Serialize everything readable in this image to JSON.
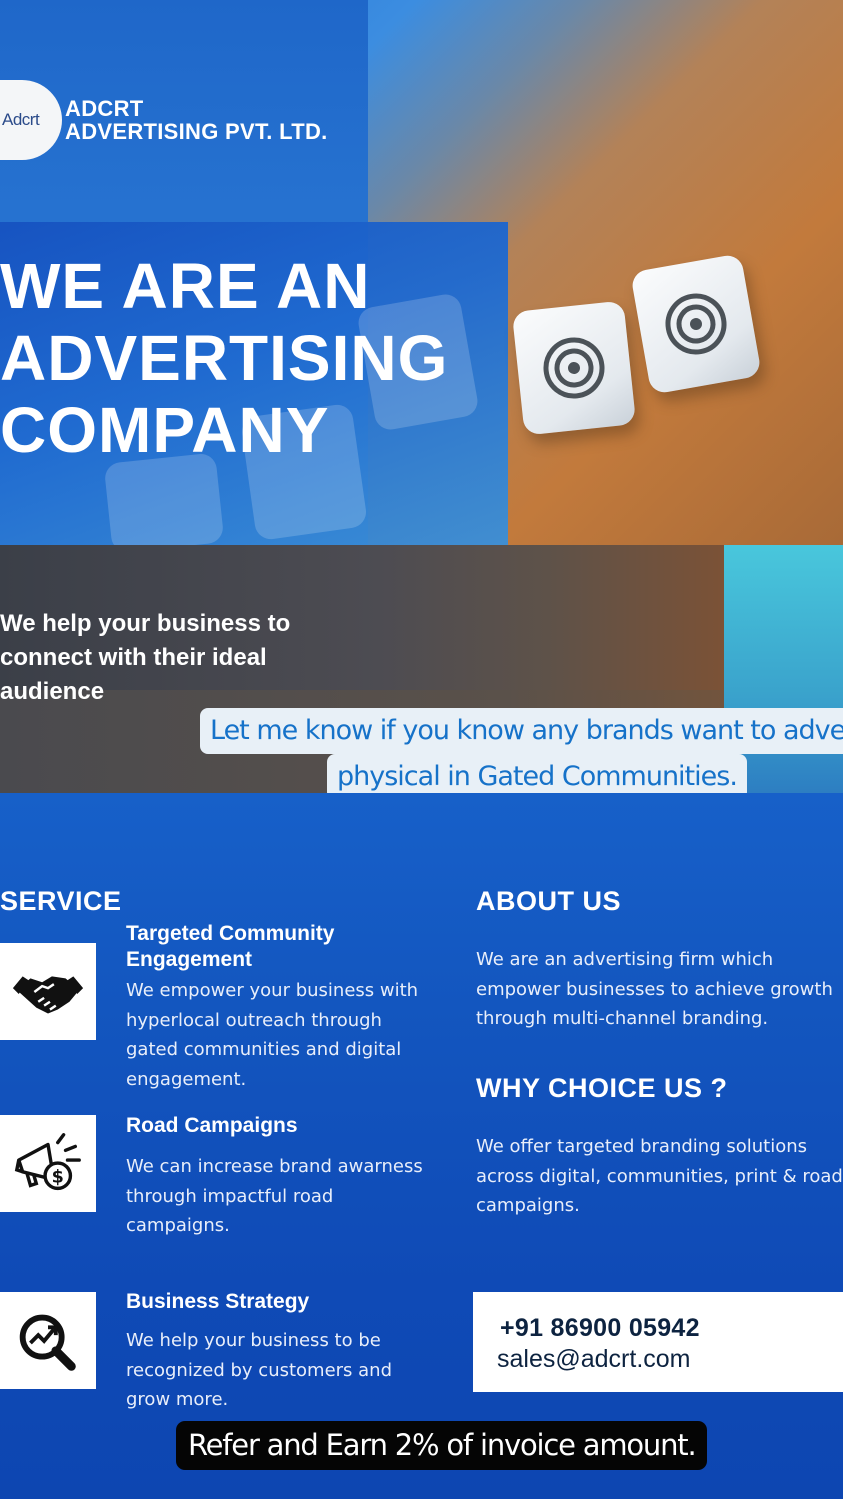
{
  "brand": {
    "logo_mark": "Adcrt",
    "name_line1": "ADCRT",
    "name_line2": "ADVERTISING PVT. LTD."
  },
  "hero": {
    "headline": [
      "WE ARE AN",
      "ADVERTISING",
      "COMPANY"
    ]
  },
  "tagline": [
    "We help your business to",
    "connect with their ideal",
    "audience"
  ],
  "overlay_text": {
    "line1": "Let me know if you know any brands want to advertise",
    "line2": "physical in Gated Communities."
  },
  "service": {
    "heading": "SERVICE",
    "items": [
      {
        "icon": "handshake-icon",
        "title_lines": [
          "Targeted Community",
          "Engagement"
        ],
        "desc_lines": [
          "We empower your business with",
          "hyperlocal outreach through",
          "gated communities and digital",
          "engagement."
        ]
      },
      {
        "icon": "megaphone-dollar-icon",
        "title_lines": [
          "Road Campaigns"
        ],
        "desc_lines": [
          "We can increase brand awarness",
          "through impactful road",
          "campaigns."
        ]
      },
      {
        "icon": "magnifier-growth-icon",
        "title_lines": [
          "Business Strategy"
        ],
        "desc_lines": [
          "We help your business to be",
          "recognized by customers and",
          "grow more."
        ]
      }
    ]
  },
  "about": {
    "heading": "ABOUT US",
    "lines": [
      "We are an advertising firm which",
      "empower businesses to achieve growth",
      "through multi-channel branding."
    ]
  },
  "why": {
    "heading": "WHY CHOICE US ?",
    "lines": [
      "We offer targeted branding solutions",
      "across digital, communities, print & road",
      "campaigns."
    ]
  },
  "contact": {
    "phone": "+91 86900 05942",
    "email": "sales@adcrt.com"
  },
  "refer_text": "Refer and Earn 2% of invoice amount.",
  "colors": {
    "primary_blue": "#1356bf",
    "accent_cyan": "#49c7dc",
    "overlay_text": "#1672c9",
    "dark_text": "#0d2340"
  }
}
